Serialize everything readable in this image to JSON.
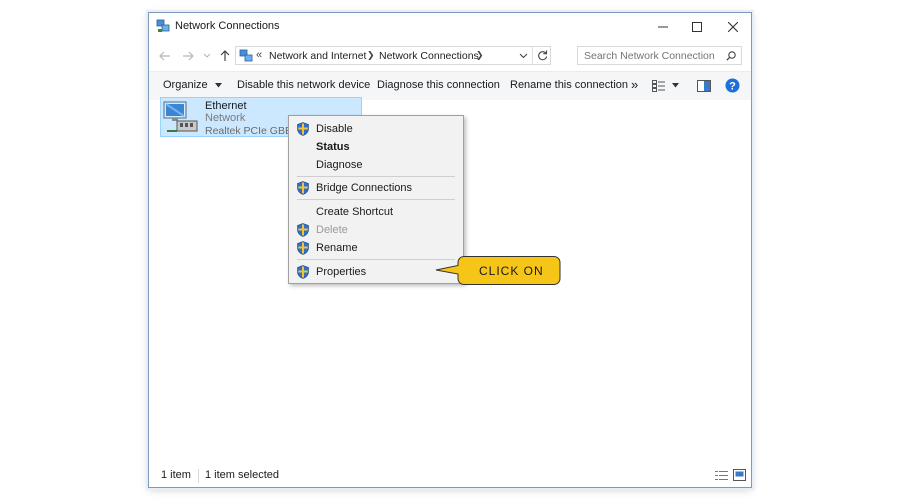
{
  "window": {
    "title": "Network Connections"
  },
  "address": {
    "overflow": "«",
    "crumb1": "Network and Internet",
    "crumb2": "Network Connections"
  },
  "search": {
    "placeholder": "Search Network Connections"
  },
  "toolbar": {
    "organize": "Organize",
    "disable": "Disable this network device",
    "diagnose": "Diagnose this connection",
    "rename": "Rename this connection",
    "more": "»"
  },
  "item": {
    "name": "Ethernet",
    "status": "Network",
    "device": "Realtek PCIe GBE Family Controller"
  },
  "context_menu": {
    "disable": "Disable",
    "status": "Status",
    "diagnose": "Diagnose",
    "bridge": "Bridge Connections",
    "shortcut": "Create Shortcut",
    "delete": "Delete",
    "rename": "Rename",
    "properties": "Properties"
  },
  "callout": {
    "text": "CLICK ON",
    "color": "#f5c518"
  },
  "statusbar": {
    "count": "1 item",
    "selected": "1 item selected"
  },
  "colors": {
    "selection": "#cce8ff",
    "help": "#1e6fd9"
  }
}
